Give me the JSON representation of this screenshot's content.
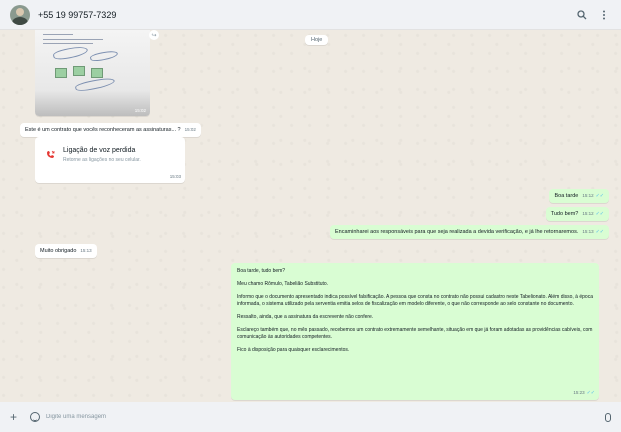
{
  "header": {
    "contact_name": "+55 19 99757-7329",
    "search_icon": "search-icon",
    "menu_icon": "more-vertical-icon"
  },
  "chat": {
    "date_chip": "Hoje",
    "image_message": {
      "time": "15:02",
      "forward_icon": "forward-icon"
    },
    "caption_message": {
      "text": "Este é  um contrato que vocês reconheceram as assinaturas... ?",
      "time": "15:02"
    },
    "missed_call": {
      "title": "Ligação de voz perdida",
      "subtitle": "Retorne as ligações no seu celular.",
      "time": "15:03",
      "icon": "missed-call-icon"
    },
    "outgoing": [
      {
        "text": "Boa tarde",
        "time": "15:12"
      },
      {
        "text": "Tudo bem?",
        "time": "15:12"
      },
      {
        "text": "Encaminharei aos responsáveis para que seja realizada a devida verificação, e já lhe retornaremos.",
        "time": "15:13"
      }
    ],
    "incoming_thanks": {
      "text": "Muito obrigado",
      "time": "15:13"
    },
    "long_message": {
      "paragraphs": [
        "Boa tarde, tudo bem?",
        "Meu chamo Rômulo, Tabelião Substituto.",
        "Informo que o documento apresentado indica possível falsificação. A pessoa que consta no contrato não possui cadastro neste Tabelionato. Além disso, à época informada, o sistema utilizado pela serventia emitia selos de fiscalização em modelo diferente, o que não corresponde ao selo constante no documento.",
        "Ressalto, ainda, que a assinatura da escrevente não confere.",
        "Esclareço também que, no mês passado, recebemos um contrato extremamente semelhante, situação em que já foram adotadas as providências cabíveis, com comunicação às autoridades competentes.",
        "Fico à disposição para quaisquer esclarecimentos."
      ],
      "time": "15:23"
    }
  },
  "footer": {
    "placeholder": "Digite uma mensagem",
    "plus_icon": "plus-icon",
    "emoji_icon": "sticker-icon",
    "mic_icon": "mic-icon"
  }
}
